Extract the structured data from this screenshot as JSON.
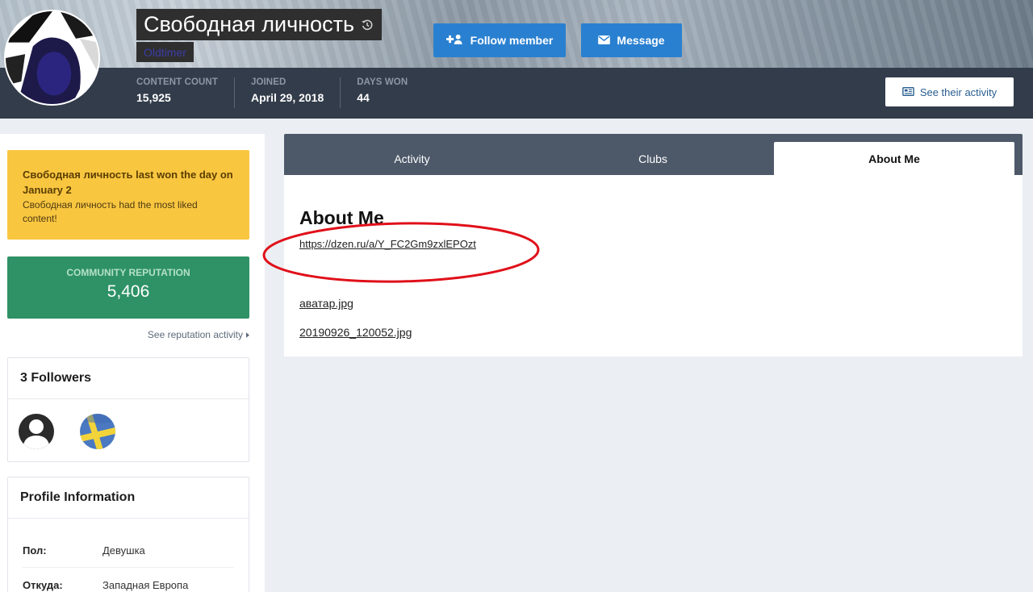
{
  "profile": {
    "name": "Свободная личность",
    "group": "Oldtimer",
    "follow_label": "Follow member",
    "message_label": "Message",
    "see_activity_label": "See their activity",
    "stats": [
      {
        "label": "CONTENT COUNT",
        "value": "15,925"
      },
      {
        "label": "JOINED",
        "value": "April 29, 2018"
      },
      {
        "label": "DAYS WON",
        "value": "44"
      }
    ]
  },
  "sidebar": {
    "day_won": {
      "title": "Свободная личность last won the day on January 2",
      "description": "Свободная личность had the most liked content!"
    },
    "reputation": {
      "label": "COMMUNITY REPUTATION",
      "value": "5,406",
      "link": "See reputation activity"
    },
    "followers": {
      "title": "3 Followers"
    },
    "profile_info": {
      "title": "Profile Information",
      "rows": [
        {
          "label": "Пол:",
          "value": "Девушка"
        },
        {
          "label": "Откуда:",
          "value": "Западная Европа"
        }
      ]
    }
  },
  "main": {
    "tabs": [
      {
        "label": "Activity"
      },
      {
        "label": "Clubs"
      },
      {
        "label": "About Me"
      }
    ],
    "about": {
      "title": "About Me",
      "link": "https://dzen.ru/a/Y_FC2Gm9zxlEPOzt",
      "files": [
        "аватар.jpg",
        "20190926_120052.jpg"
      ]
    }
  },
  "colors": {
    "header_bar": "#323c4a",
    "primary_button": "#2a80d0",
    "day_won_bg": "#f9c640",
    "reputation_bg": "#2e9266",
    "tabs_bg": "#4d5969",
    "annotation": "#e0101a"
  }
}
